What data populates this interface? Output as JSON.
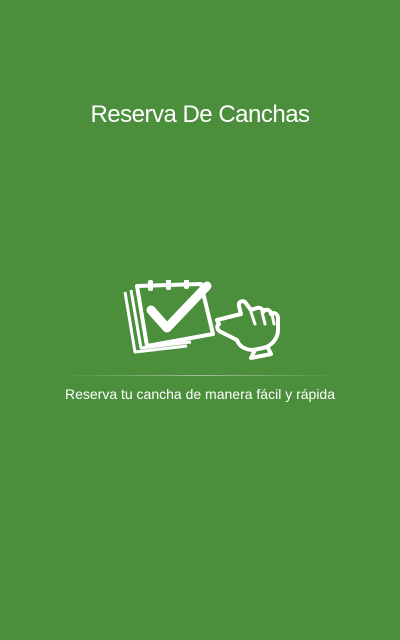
{
  "splash": {
    "title": "Reserva De Canchas",
    "tagline": "Reserva tu cancha de manera fácil y rápida",
    "logo_icon": "calendar-check-hand-icon"
  },
  "colors": {
    "background": "#4b8e3c",
    "foreground": "#ffffff"
  }
}
